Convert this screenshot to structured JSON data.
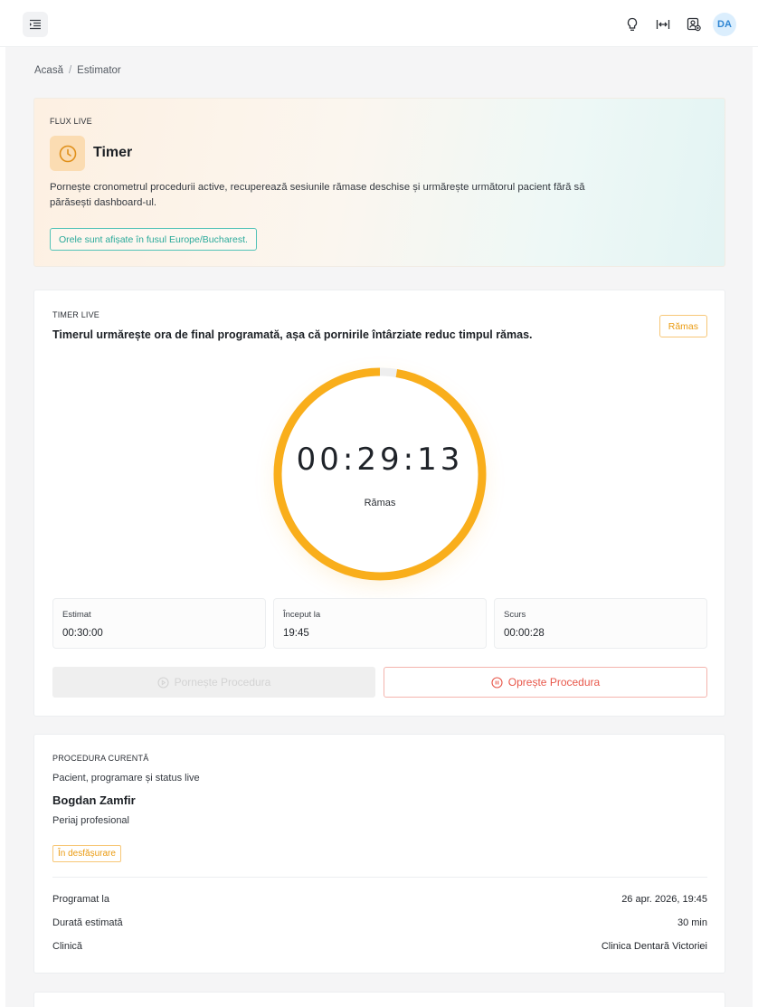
{
  "topbar": {
    "avatar_initials": "DA",
    "icons": [
      "menu-indent-icon",
      "lightbulb-icon",
      "width-icon",
      "user-badge-icon"
    ]
  },
  "breadcrumb": {
    "home": "Acasă",
    "separator": "/",
    "current": "Estimator"
  },
  "hero": {
    "eyebrow": "FLUX LIVE",
    "title": "Timer",
    "description": "Pornește cronometrul procedurii active, recuperează sesiunile rămase deschise și urmărește următorul pacient fără să părăsești dashboard-ul.",
    "timezone_badge": "Orele sunt afișate în fusul Europe/Bucharest.",
    "icon": "clock-icon",
    "accent_color": "#f4a422"
  },
  "timer": {
    "eyebrow": "TIMER LIVE",
    "heading": "Timerul urmărește ora de final programată, așa că pornirile întârziate reduc timpul rămas.",
    "mode_badge": "Rămas",
    "time": "00:29:13",
    "time_label": "Rămas",
    "remaining_fraction": 0.974,
    "ring_color": "#f9ae1b",
    "stats": [
      {
        "label": "Estimat",
        "value": "00:30:00"
      },
      {
        "label": "Început la",
        "value": "19:45"
      },
      {
        "label": "Scurs",
        "value": "00:00:28"
      }
    ],
    "start_button": "Pornește Procedura",
    "stop_button": "Oprește Procedura",
    "stop_color": "#e8574a"
  },
  "procedure": {
    "eyebrow": "PROCEDURA CURENTĂ",
    "subtitle": "Pacient, programare și status live",
    "patient": "Bogdan Zamfir",
    "treatment": "Periaj profesional",
    "status": "În desfășurare",
    "details": [
      {
        "key": "Programat la",
        "value": "26 apr. 2026, 19:45"
      },
      {
        "key": "Durată estimată",
        "value": "30 min"
      },
      {
        "key": "Clinică",
        "value": "Clinica Dentară Victoriei"
      }
    ]
  }
}
